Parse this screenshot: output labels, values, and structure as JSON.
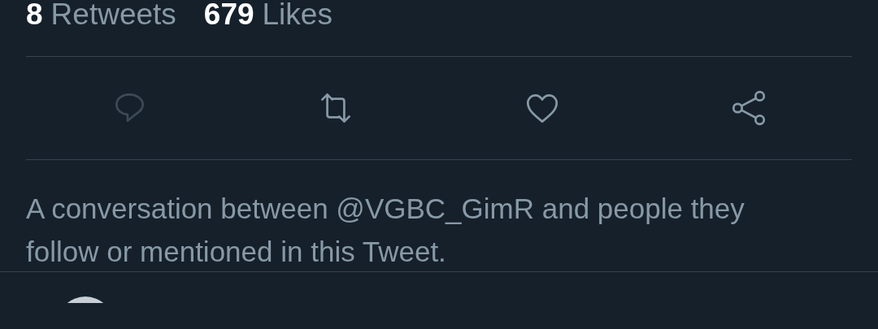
{
  "stats": [
    {
      "count": "8",
      "label": "Retweets"
    },
    {
      "count": "679",
      "label": "Likes"
    }
  ],
  "actions": [
    {
      "kind": "reply",
      "disabled": true
    },
    {
      "kind": "retweet",
      "disabled": false
    },
    {
      "kind": "like",
      "disabled": false
    },
    {
      "kind": "share",
      "disabled": false
    }
  ],
  "conversation_note": "A conversation between @VGBC_GimR and people they follow or mentioned in this Tweet."
}
